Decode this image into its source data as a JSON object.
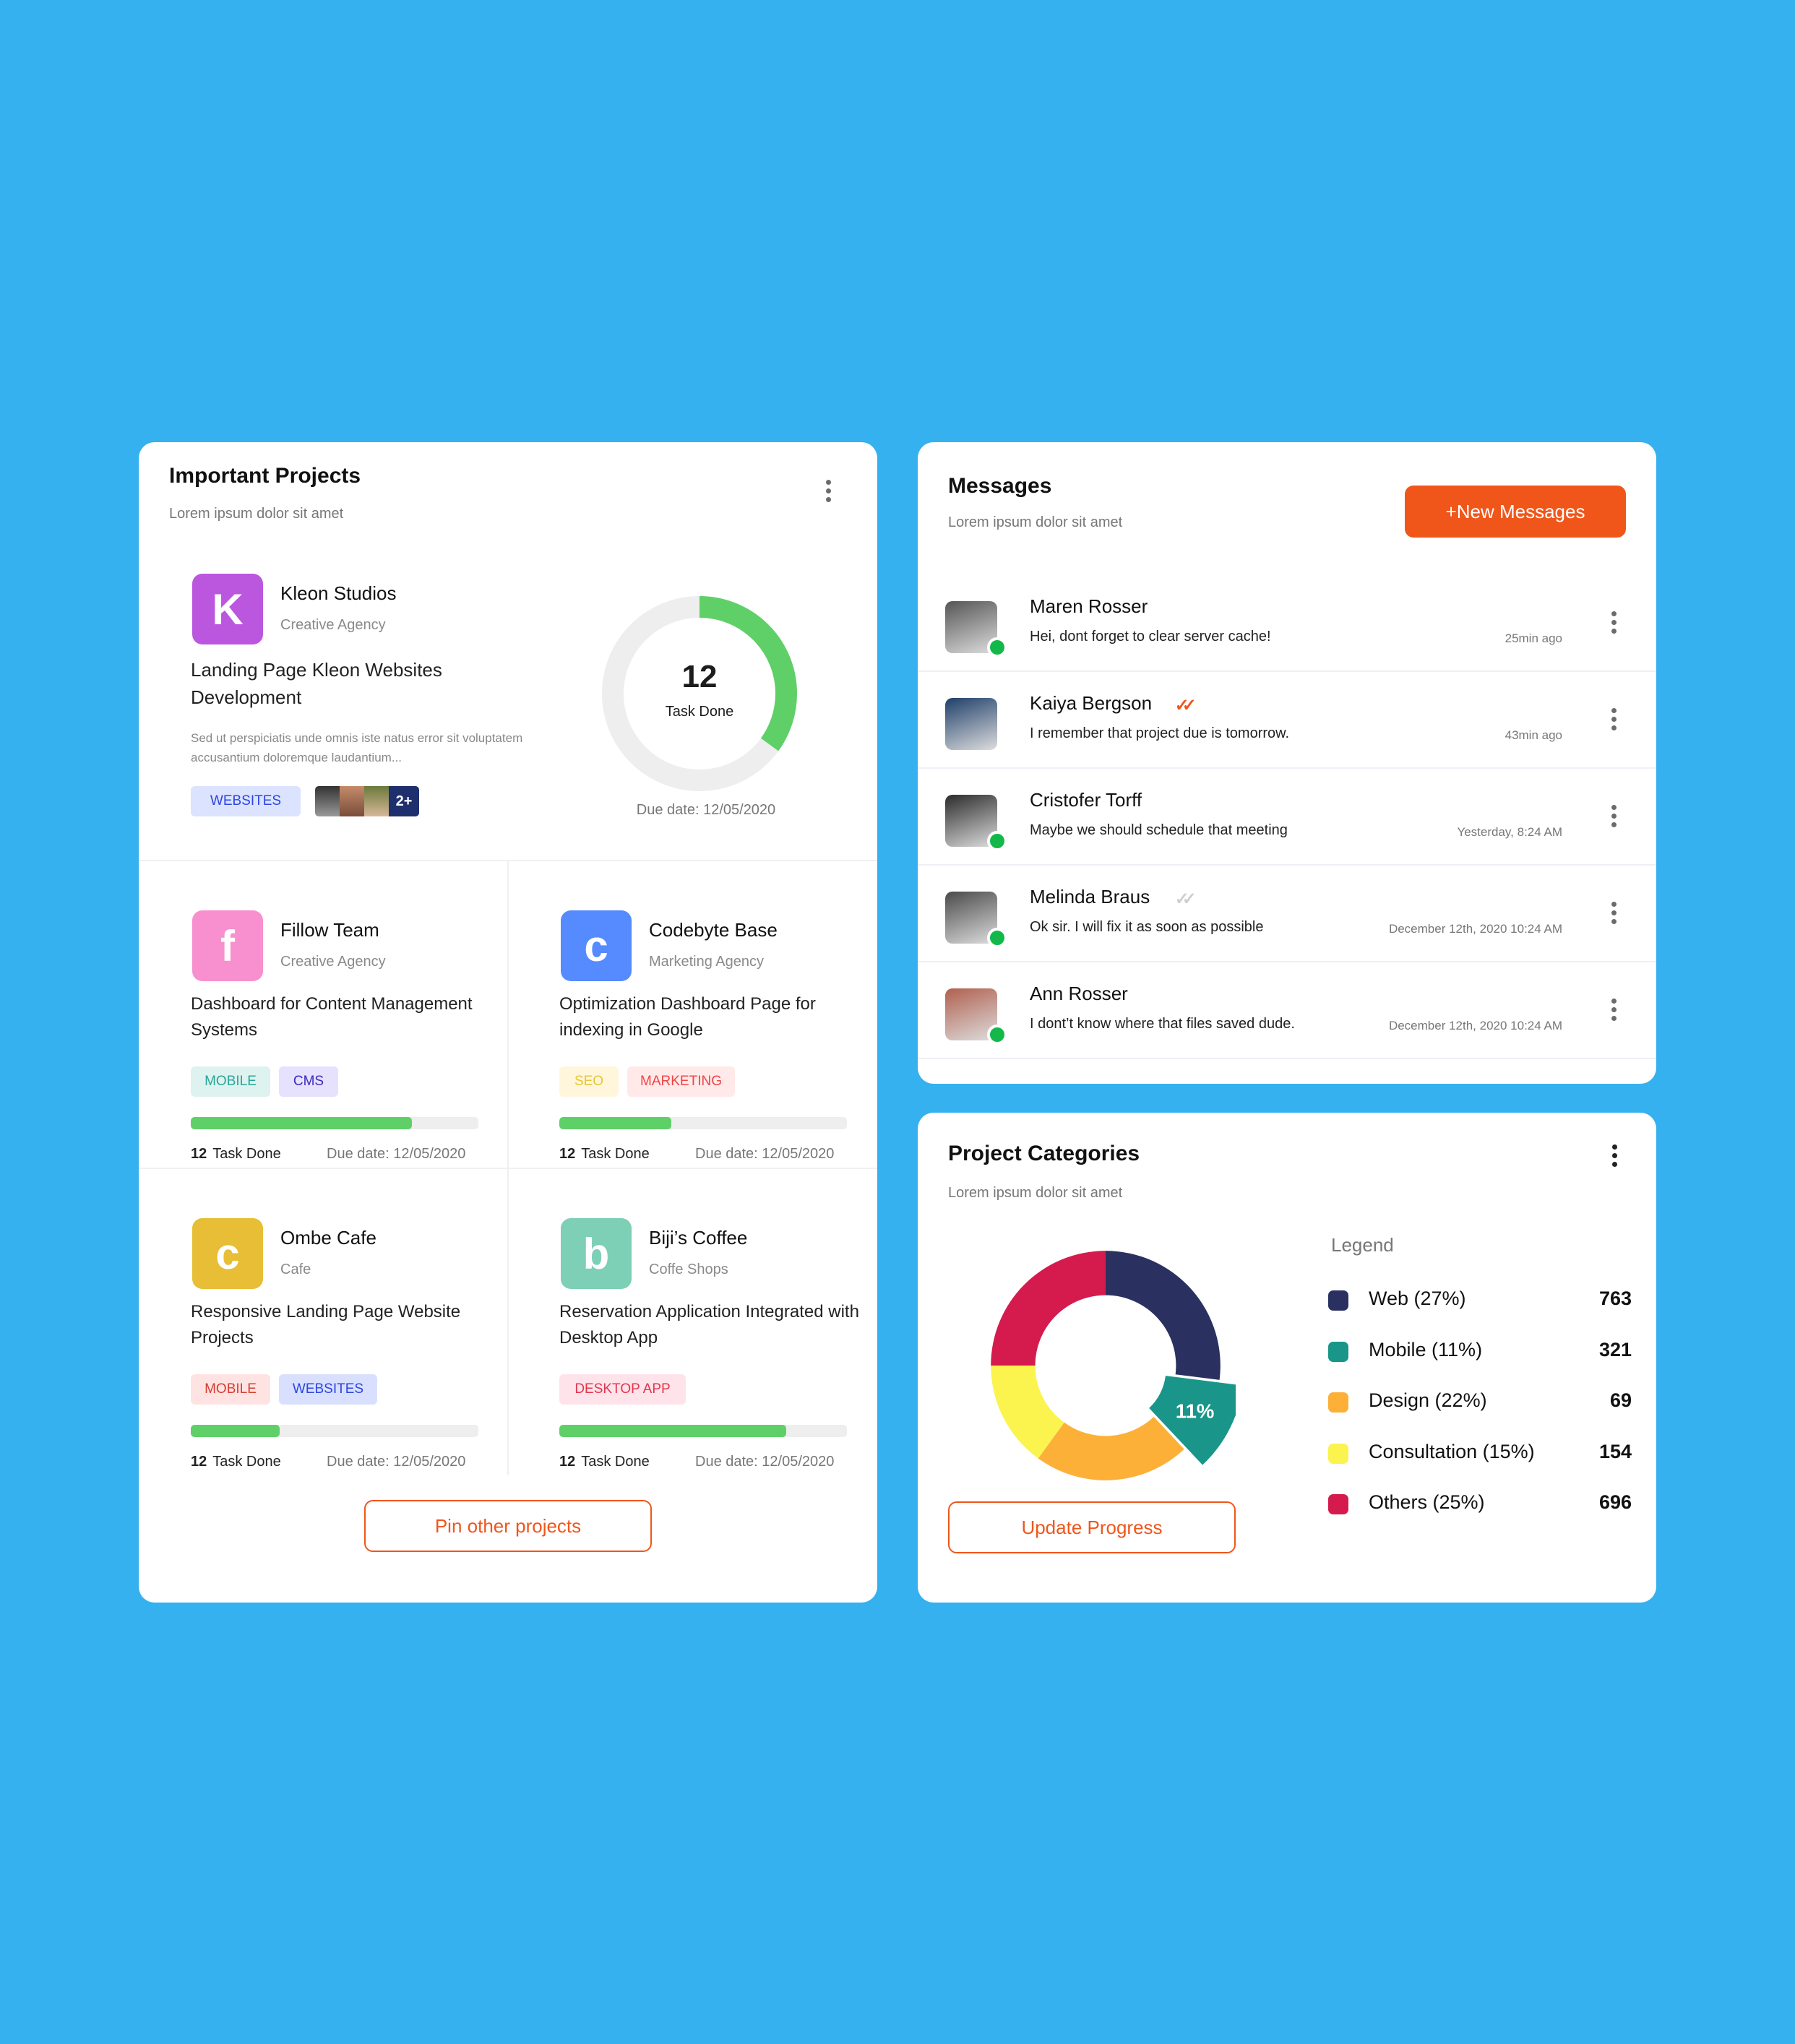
{
  "projects_card": {
    "title": "Important Projects",
    "subtitle": "Lorem ipsum dolor sit amet",
    "featured": {
      "logo_letter": "K",
      "logo_color": "#bb57de",
      "name": "Kleon Studios",
      "category": "Creative Agency",
      "title": "Landing Page Kleon Websites Development",
      "description": "Sed ut perspiciatis unde omnis iste natus error sit voluptatem accusantium doloremque laudantium...",
      "tag": "WEBSITES",
      "more_members": "2+",
      "tasks_done": "12",
      "tasks_label": "Task Done",
      "progress": 0.35,
      "due": "Due date: 12/05/2020"
    },
    "projects": [
      {
        "logo_letter": "f",
        "logo_color": "#f88fce",
        "name": "Fillow Team",
        "category": "Creative Agency",
        "title": "Dashboard for Content Management Systems",
        "tags": [
          {
            "label": "MOBILE",
            "bg": "#def2ef",
            "fg": "#27a79a"
          },
          {
            "label": "CMS",
            "bg": "#e6e1fd",
            "fg": "#3a2bbd"
          }
        ],
        "progress": 0.77,
        "tasks_done": "12",
        "tasks_label": "Task Done",
        "due": "Due date: 12/05/2020"
      },
      {
        "logo_letter": "c",
        "logo_color": "#568bff",
        "name": "Codebyte Base",
        "category": "Marketing Agency",
        "title": "Optimization Dashboard Page for indexing in Google",
        "tags": [
          {
            "label": "SEO",
            "bg": "#fff6dc",
            "fg": "#e7c62f"
          },
          {
            "label": "MARKETING",
            "bg": "#ffe9e9",
            "fg": "#f04545"
          }
        ],
        "progress": 0.39,
        "tasks_done": "12",
        "tasks_label": "Task Done",
        "due": "Due date: 12/05/2020"
      },
      {
        "logo_letter": "c",
        "logo_color": "#e7be35",
        "name": "Ombe Cafe",
        "category": "Cafe",
        "title": "Responsive Landing Page Website Projects",
        "tags": [
          {
            "label": "MOBILE",
            "bg": "#ffe3e3",
            "fg": "#d63d2f"
          },
          {
            "label": "WEBSITES",
            "bg": "#d9e0ff",
            "fg": "#2d45e0"
          }
        ],
        "progress": 0.31,
        "tasks_done": "12",
        "tasks_label": "Task Done",
        "due": "Due date: 12/05/2020"
      },
      {
        "logo_letter": "b",
        "logo_color": "#7dcfb6",
        "name": "Biji’s Coffee",
        "category": "Coffe Shops",
        "title": "Reservation Application Integrated with Desktop App",
        "tags": [
          {
            "label": "DESKTOP APP",
            "bg": "#ffe3ea",
            "fg": "#e2354e"
          }
        ],
        "progress": 0.79,
        "tasks_done": "12",
        "tasks_label": "Task Done",
        "due": "Due date: 12/05/2020"
      }
    ],
    "pin_button": "Pin other projects"
  },
  "messages_card": {
    "title": "Messages",
    "subtitle": "Lorem ipsum dolor sit amet",
    "new_button": "+New Messages",
    "items": [
      {
        "name": "Maren Rosser",
        "text": "Hei, dont forget to clear server cache!",
        "time": "25min ago",
        "online": true,
        "read": "none",
        "avatar_color": "#555"
      },
      {
        "name": "Kaiya Bergson",
        "text": "I remember that project due is tomorrow.",
        "time": "43min ago",
        "online": false,
        "read": "read",
        "avatar_color": "#1f3f6a"
      },
      {
        "name": "Cristofer Torff",
        "text": "Maybe we should schedule that meeting",
        "time": "Yesterday, 8:24 AM",
        "online": true,
        "read": "none",
        "avatar_color": "#2b2b2b"
      },
      {
        "name": "Melinda Braus",
        "text": "Ok sir. I will fix it as soon as possible",
        "time": "December 12th, 2020  10:24 AM",
        "online": true,
        "read": "sent",
        "avatar_color": "#4a4a4a"
      },
      {
        "name": "Ann Rosser",
        "text": "I dont’t know where that files saved dude.",
        "time": "December 12th, 2020  10:24 AM",
        "online": true,
        "read": "none",
        "avatar_color": "#b0604f"
      }
    ]
  },
  "categories_card": {
    "title": "Project Categories",
    "subtitle": "Lorem ipsum dolor sit amet",
    "update_button": "Update Progress",
    "legend_title": "Legend"
  },
  "chart_data": {
    "type": "pie",
    "title": "Project Categories",
    "donut": true,
    "highlighted": "Mobile",
    "highlight_label": "11%",
    "legend_position": "right",
    "series": [
      {
        "name": "Web",
        "percent": 27,
        "value": 763,
        "label": "Web (27%)",
        "color": "#2a3160"
      },
      {
        "name": "Mobile",
        "percent": 11,
        "value": 321,
        "label": "Mobile (11%)",
        "color": "#199689"
      },
      {
        "name": "Design",
        "percent": 22,
        "value": 69,
        "label": "Design (22%)",
        "color": "#fdb038"
      },
      {
        "name": "Consultation",
        "percent": 15,
        "value": 154,
        "label": "Consultation (15%)",
        "color": "#fbf44f"
      },
      {
        "name": "Others",
        "percent": 25,
        "value": 696,
        "label": "Others (25%)",
        "color": "#d51b4e"
      }
    ]
  }
}
